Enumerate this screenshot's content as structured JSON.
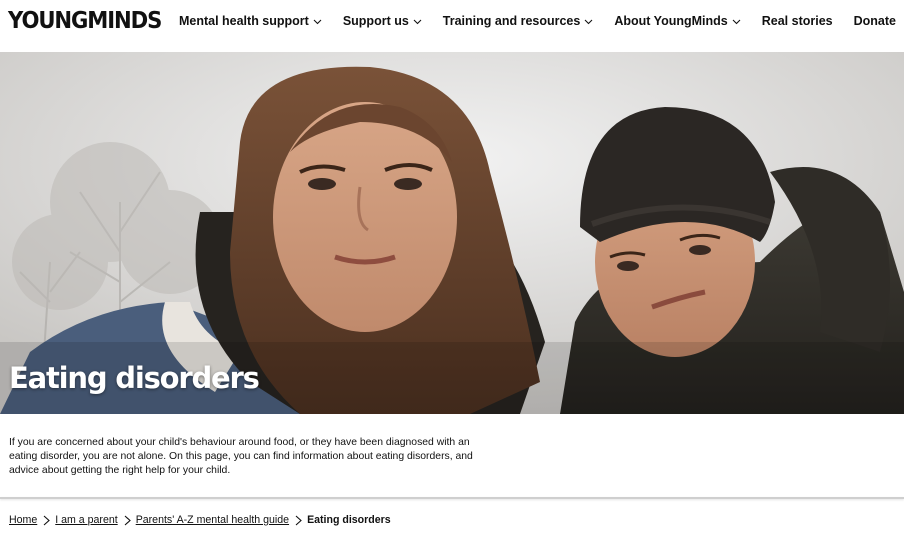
{
  "header": {
    "logo": "YOUNGMINDS",
    "nav": [
      {
        "label": "Mental health support",
        "has_dropdown": true
      },
      {
        "label": "Support us",
        "has_dropdown": true
      },
      {
        "label": "Training and resources",
        "has_dropdown": true
      },
      {
        "label": "About YoungMinds",
        "has_dropdown": true
      },
      {
        "label": "Real stories",
        "has_dropdown": false
      },
      {
        "label": "Donate",
        "has_dropdown": false
      }
    ]
  },
  "hero": {
    "title": "Eating disorders"
  },
  "intro": {
    "text": "If you are concerned about your child's behaviour around food, or they have been diagnosed with an eating disorder, you are not alone. On this page, you can find information about eating disorders, and advice about getting the right help for your child."
  },
  "breadcrumb": {
    "items": [
      "Home",
      "I am a parent",
      "Parents' A-Z mental health guide"
    ],
    "current": "Eating disorders"
  },
  "icons": {
    "nav_dropdown": "chevron-down-icon",
    "breadcrumb_separator": "chevron-right-icon"
  },
  "colors": {
    "text": "#111111",
    "background": "#ffffff",
    "hero_title": "#ffffff"
  }
}
